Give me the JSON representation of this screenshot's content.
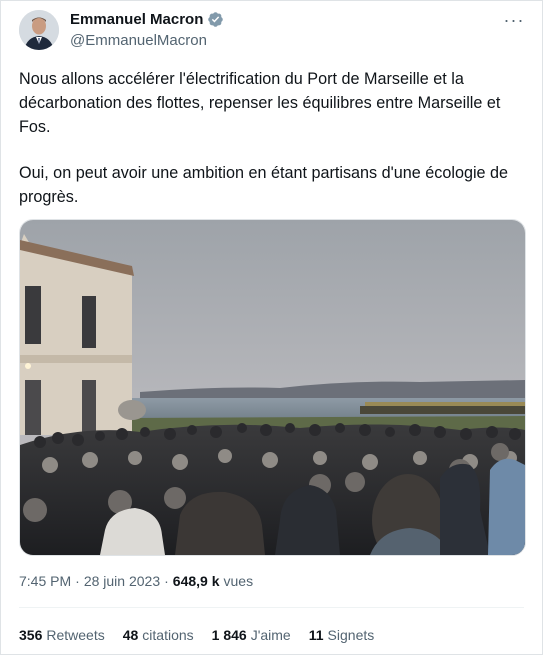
{
  "author": {
    "name": "Emmanuel Macron",
    "handle": "@EmmanuelMacron",
    "verified_icon": "verified-badge-icon",
    "badge_color": "#829aab"
  },
  "more_label": "···",
  "tweet": {
    "paragraph1": "Nous allons accélérer l'électrification du Port de Marseille et la décarbonation des flottes, repenser les équilibres entre Marseille et Fos.",
    "paragraph2": "Oui, on peut avoir une ambition en étant partisans d'une écologie de progrès."
  },
  "meta": {
    "time": "7:45 PM",
    "dot1": "·",
    "date": "28 juin 2023",
    "dot2": "·",
    "views_count": "648,9 k",
    "views_label": "vues"
  },
  "stats": {
    "retweets_count": "356",
    "retweets_label": "Retweets",
    "quotes_count": "48",
    "quotes_label": "citations",
    "likes_count": "1 846",
    "likes_label": "J'aime",
    "bookmarks_count": "11",
    "bookmarks_label": "Signets"
  },
  "colors": {
    "text_primary": "#0f1419",
    "text_secondary": "#536471",
    "border": "#dfe3e6"
  }
}
